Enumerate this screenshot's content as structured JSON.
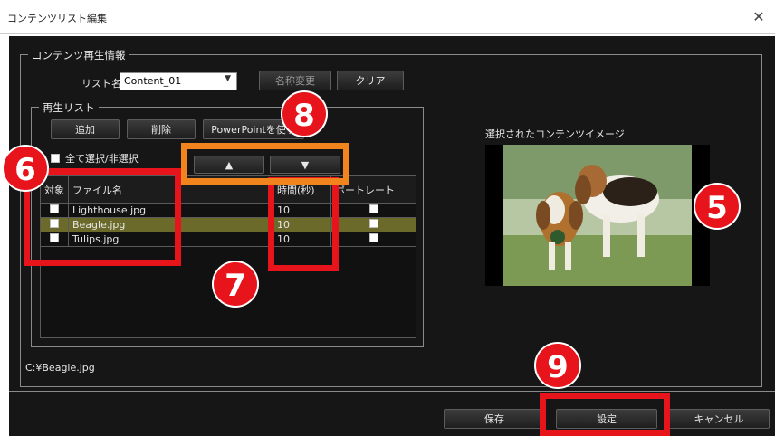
{
  "window": {
    "title": "コンテンツリスト編集",
    "close_glyph": "✕"
  },
  "content_info": {
    "legend": "コンテンツ再生情報",
    "list_name_label": "リスト名",
    "list_name_value": "Content_01",
    "rename_button": "名称変更",
    "clear_button": "クリア"
  },
  "playlist": {
    "legend": "再生リスト",
    "add_button": "追加",
    "delete_button": "削除",
    "powerpoint_button": "PowerPointを使う",
    "select_all_label": "全て選択/非選択",
    "up_button": "▲",
    "down_button": "▼",
    "columns": [
      "対象",
      "ファイル名",
      "時間(秒)",
      "ポートレート"
    ],
    "rows": [
      {
        "file": "Lighthouse.jpg",
        "seconds": "10",
        "selected": false
      },
      {
        "file": "Beagle.jpg",
        "seconds": "10",
        "selected": true
      },
      {
        "file": "Tulips.jpg",
        "seconds": "10",
        "selected": false
      }
    ]
  },
  "preview": {
    "label": "選択されたコンテンツイメージ"
  },
  "path": "C:¥Beagle.jpg",
  "footer": {
    "save_button": "保存",
    "set_button": "設定",
    "cancel_button": "キャンセル"
  },
  "callouts": [
    "5",
    "6",
    "7",
    "8",
    "9"
  ],
  "colors": {
    "callout_red": "#e8141b",
    "callout_orange": "#f2841e",
    "selected_row": "#6b6a2a"
  }
}
